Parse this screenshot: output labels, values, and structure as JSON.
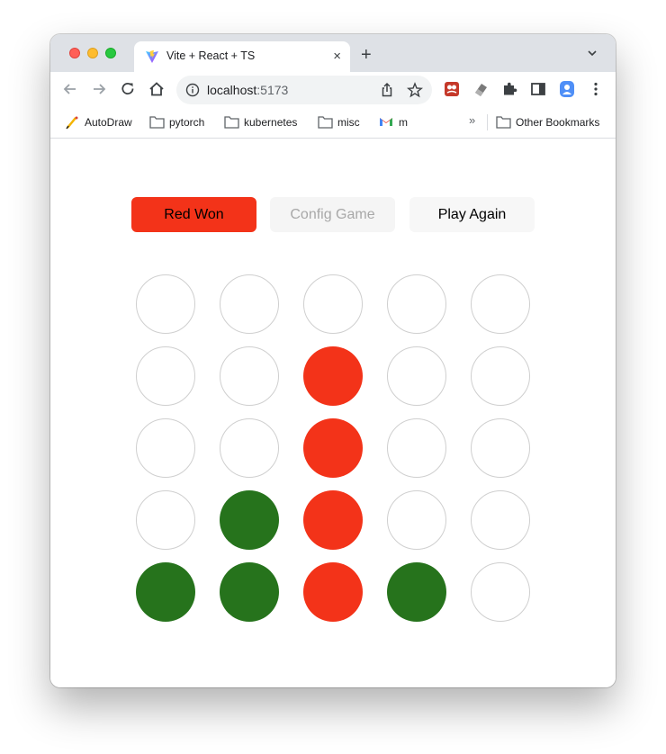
{
  "browser": {
    "tab_title": "Vite + React + TS",
    "tab_close": "×",
    "new_tab": "+",
    "url_host": "localhost",
    "url_port": ":5173",
    "bookmarks": [
      {
        "label": "AutoDraw",
        "icon": "autodraw-icon"
      },
      {
        "label": "pytorch",
        "icon": "folder-icon"
      },
      {
        "label": "kubernetes",
        "icon": "folder-icon"
      },
      {
        "label": "misc",
        "icon": "folder-icon"
      },
      {
        "label": "m",
        "icon": "gmail-icon"
      }
    ],
    "overflow": "»",
    "other_bookmarks": "Other Bookmarks"
  },
  "game": {
    "status_label": "Red Won",
    "config_label": "Config Game",
    "play_again_label": "Play Again",
    "colors": {
      "red": "#f33319",
      "green": "#26731c",
      "empty_border": "#cfcfcf"
    },
    "board": [
      [
        "empty",
        "empty",
        "empty",
        "empty",
        "empty"
      ],
      [
        "empty",
        "empty",
        "red",
        "empty",
        "empty"
      ],
      [
        "empty",
        "empty",
        "red",
        "empty",
        "empty"
      ],
      [
        "empty",
        "green",
        "red",
        "empty",
        "empty"
      ],
      [
        "green",
        "green",
        "red",
        "green",
        "empty"
      ]
    ]
  }
}
